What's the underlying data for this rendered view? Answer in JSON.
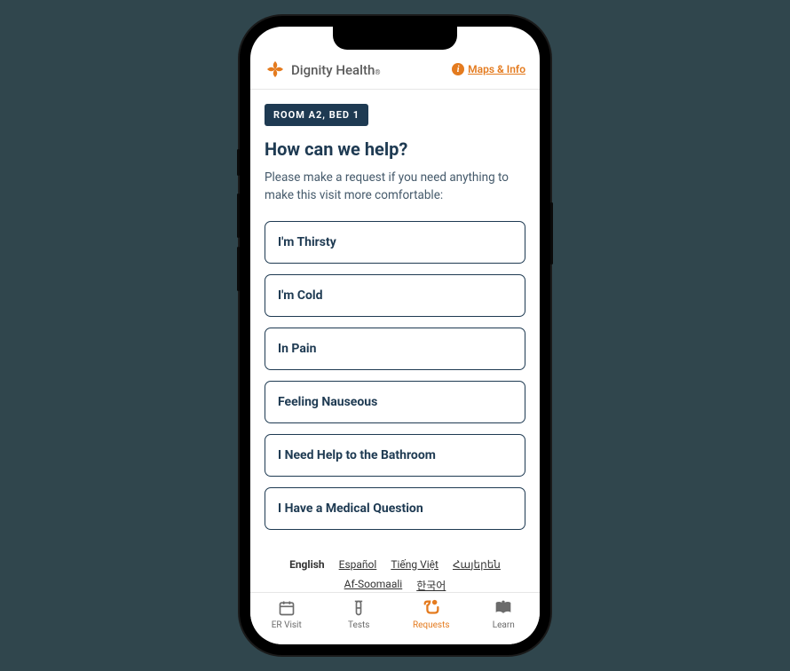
{
  "header": {
    "brand_name": "Dignity Health",
    "maps_link_label": "Maps & Info"
  },
  "room_badge": "ROOM A2, BED 1",
  "title": "How can we help?",
  "subtitle": "Please make a request if you need anything to make this visit more comfortable:",
  "options": [
    "I'm Thirsty",
    "I'm Cold",
    "In Pain",
    "Feeling Nauseous",
    "I Need Help to the Bathroom",
    "I Have a Medical Question"
  ],
  "languages": [
    {
      "label": "English",
      "active": true
    },
    {
      "label": "Español",
      "active": false
    },
    {
      "label": "Tiếng Việt",
      "active": false
    },
    {
      "label": "Հայերեն",
      "active": false
    },
    {
      "label": "Af-Soomaali",
      "active": false
    },
    {
      "label": "한국어",
      "active": false
    }
  ],
  "nav": [
    {
      "label": "ER Visit",
      "icon": "calendar",
      "active": false
    },
    {
      "label": "Tests",
      "icon": "vial",
      "active": false
    },
    {
      "label": "Requests",
      "icon": "request",
      "active": true
    },
    {
      "label": "Learn",
      "icon": "book",
      "active": false
    }
  ]
}
